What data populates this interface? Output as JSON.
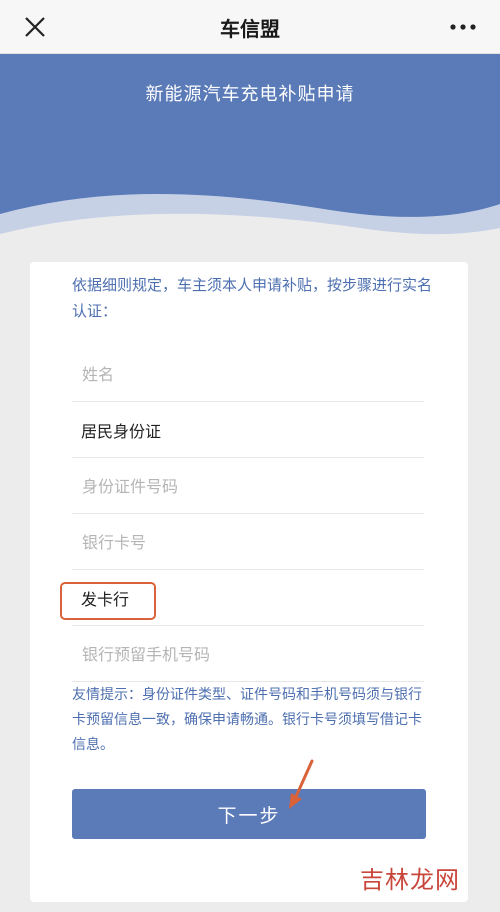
{
  "header": {
    "title": "车信盟",
    "close_icon": "close-icon",
    "more_icon": "more-dots-icon"
  },
  "banner": {
    "title": "新能源汽车充电补贴申请"
  },
  "form": {
    "intro": "依据细则规定，车主须本人申请补贴，按步骤进行实名认证：",
    "name_placeholder": "姓名",
    "id_type_value": "居民身份证",
    "id_number_placeholder": "身份证件号码",
    "bank_card_placeholder": "银行卡号",
    "issuer_value": "发卡行",
    "phone_placeholder": "银行预留手机号码",
    "tip": "友情提示：身份证件类型、证件号码和手机号码须与银行卡预留信息一致，确保申请畅通。银行卡号须填写借记卡信息。",
    "next_label": "下一步"
  },
  "watermark": "吉林龙网",
  "colors": {
    "brand": "#5a7ab8",
    "tip_text": "#4d6fb0",
    "highlight": "#d9623b",
    "watermark": "#c9463b"
  }
}
